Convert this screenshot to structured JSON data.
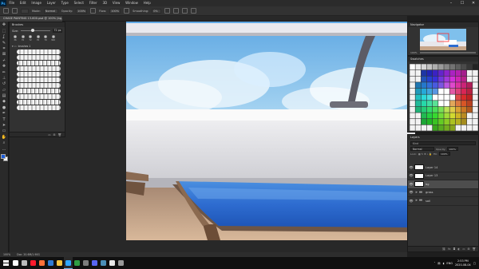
{
  "app": {
    "logo": "Ps",
    "menu": [
      "File",
      "Edit",
      "Image",
      "Layer",
      "Type",
      "Select",
      "Filter",
      "3D",
      "View",
      "Window",
      "Help"
    ],
    "window_controls": [
      "minimize-icon",
      "maximize-icon",
      "close-icon"
    ]
  },
  "options": {
    "mode_label": "Mode:",
    "mode_value": "Normal",
    "opacity_label": "Opacity:",
    "opacity_value": "100%",
    "flow_label": "Flow:",
    "flow_value": "100%",
    "smoothing_label": "Smoothing:",
    "smoothing_value": "0%"
  },
  "document": {
    "tab_title": "CHASE PAINTING 13-600.psd @ 100% (bg, RGB/8)"
  },
  "tools": [
    {
      "name": "move-tool-icon",
      "glyph": "✥"
    },
    {
      "name": "marquee-tool-icon",
      "glyph": "⬚"
    },
    {
      "name": "lasso-tool-icon",
      "glyph": "ʆ"
    },
    {
      "name": "quick-select-tool-icon",
      "glyph": "✎"
    },
    {
      "name": "crop-tool-icon",
      "glyph": "⌗"
    },
    {
      "name": "frame-tool-icon",
      "glyph": "⊠"
    },
    {
      "name": "eyedropper-tool-icon",
      "glyph": "⌿"
    },
    {
      "name": "healing-brush-tool-icon",
      "glyph": "✚"
    },
    {
      "name": "brush-tool-icon",
      "glyph": "✏"
    },
    {
      "name": "clone-stamp-tool-icon",
      "glyph": "⊥"
    },
    {
      "name": "history-brush-tool-icon",
      "glyph": "↺"
    },
    {
      "name": "eraser-tool-icon",
      "glyph": "▱"
    },
    {
      "name": "gradient-tool-icon",
      "glyph": "▤"
    },
    {
      "name": "blur-tool-icon",
      "glyph": "◆"
    },
    {
      "name": "dodge-tool-icon",
      "glyph": "●"
    },
    {
      "name": "pen-tool-icon",
      "glyph": "✒"
    },
    {
      "name": "type-tool-icon",
      "glyph": "T"
    },
    {
      "name": "path-select-tool-icon",
      "glyph": "➤"
    },
    {
      "name": "rectangle-tool-icon",
      "glyph": "▭"
    },
    {
      "name": "hand-tool-icon",
      "glyph": "✋"
    },
    {
      "name": "zoom-tool-icon",
      "glyph": "⌕"
    },
    {
      "name": "more-tools-icon",
      "glyph": "…"
    }
  ],
  "brushes": {
    "title": "Brushes",
    "size_label": "Size:",
    "size_value": "72 px",
    "presets": [
      "36",
      "70",
      "72",
      "70",
      "79",
      "300"
    ],
    "folder_label": "brushes 1"
  },
  "status": {
    "zoom": "100%",
    "doc_size": "Doc: 20.6M/1.90G"
  },
  "navigator": {
    "title": "Navigator",
    "zoom": "100%"
  },
  "swatches": {
    "title": "Swatches"
  },
  "layers": {
    "title": "Layers",
    "search_placeholder": "Kind",
    "blend_mode": "Normal",
    "opacity_label": "Opacity:",
    "opacity_value": "100%",
    "lock_label": "Lock:",
    "fill_label": "Fill:",
    "fill_value": "100%",
    "items": [
      {
        "name": "Layer 14",
        "type": "layer",
        "selected": false
      },
      {
        "name": "Layer 13",
        "type": "layer",
        "selected": false
      },
      {
        "name": "bg",
        "type": "layer",
        "selected": true
      },
      {
        "name": "grass",
        "type": "folder",
        "selected": false
      },
      {
        "name": "sail",
        "type": "folder",
        "selected": false
      }
    ]
  },
  "taskbar": {
    "apps": [
      {
        "name": "search-icon",
        "color": "#ffffff"
      },
      {
        "name": "task-view-icon",
        "color": "#bbbbbb"
      },
      {
        "name": "opera-icon",
        "color": "#ff1b2d"
      },
      {
        "name": "firefox-icon",
        "color": "#ff7139"
      },
      {
        "name": "mail-icon",
        "color": "#2f7bd4"
      },
      {
        "name": "file-explorer-icon",
        "color": "#f4c542"
      },
      {
        "name": "photoshop-icon",
        "color": "#31a8ff"
      },
      {
        "name": "chrome-icon",
        "color": "#2f9e44"
      },
      {
        "name": "obs-icon",
        "color": "#7c7c7c"
      },
      {
        "name": "discord-icon",
        "color": "#5865f2"
      },
      {
        "name": "steam-icon",
        "color": "#4b8fb8"
      },
      {
        "name": "clip-studio-icon",
        "color": "#e8e8e8"
      },
      {
        "name": "settings-icon",
        "color": "#999999"
      }
    ],
    "tray_lang": "ENG",
    "time": "2:53 PM",
    "date": "2020-08-04"
  },
  "colors": {
    "foreground": "#1a5bd8",
    "background": "#ffffff",
    "sky": "#8ec7ee",
    "deck_blue": "#2f6ed1"
  }
}
